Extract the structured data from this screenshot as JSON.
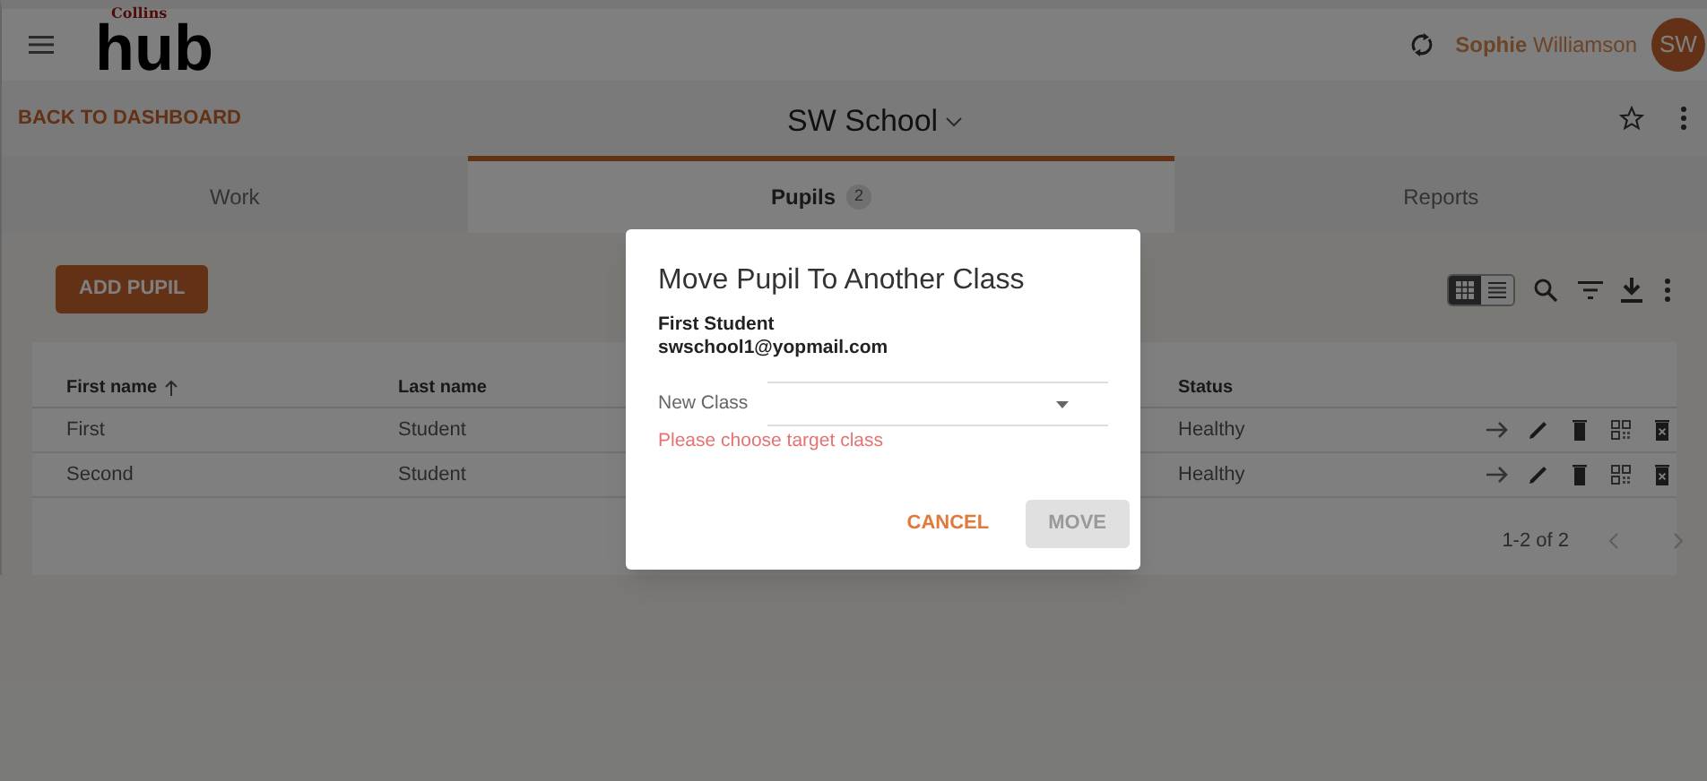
{
  "header": {
    "logo_small": "Collins",
    "logo_large": "hub",
    "user_name": "**Sophie** Williamson",
    "avatar_initials": "SW"
  },
  "subheader": {
    "back_link": "BACK TO DASHBOARD",
    "school": "SW School"
  },
  "tabs": [
    {
      "label": "Work",
      "selected": false
    },
    {
      "label": "Pupils",
      "count": "2",
      "selected": true
    },
    {
      "label": "Reports",
      "selected": false
    }
  ],
  "toolbar": {
    "add_button": "ADD PUPIL",
    "views": [
      {
        "kind": "grid",
        "selected": true
      },
      {
        "kind": "list",
        "selected": false
      }
    ]
  },
  "table": {
    "columns": [
      "First name",
      "Last name",
      "Status"
    ],
    "rows": [
      {
        "cells": [
          "First",
          "Student",
          "Healthy"
        ]
      },
      {
        "cells": [
          "Second",
          "Student",
          "Healthy"
        ]
      }
    ],
    "pagination": "1-2 of 2"
  },
  "dialog": {
    "title": "Move Pupil To Another Class",
    "pupil_name": "First Student",
    "pupil_email": "swschool1@yopmail.com",
    "field_label": "New Class",
    "error": "Please choose target class",
    "buttons": [
      {
        "label": "CANCEL",
        "kind": "text",
        "disabled": false
      },
      {
        "label": "MOVE",
        "kind": "filled",
        "disabled": true
      }
    ]
  }
}
